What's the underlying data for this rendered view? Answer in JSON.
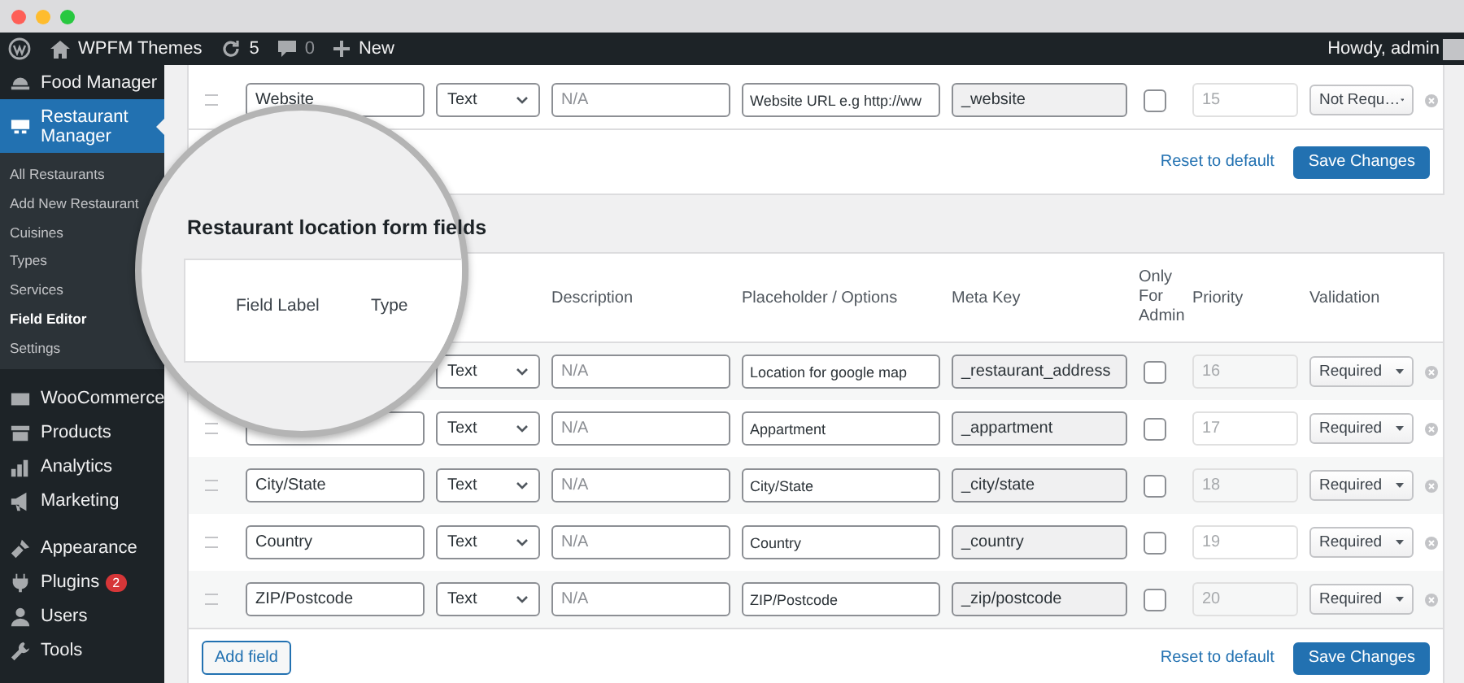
{
  "admin_bar": {
    "site": "WPFM Themes",
    "updates": "5",
    "comments": "0",
    "new": "New",
    "greeting": "Howdy, admin"
  },
  "sidebar": {
    "items": [
      {
        "label": "Food Manager",
        "selected": false
      },
      {
        "label": "Restaurant Manager",
        "selected": true,
        "children": [
          {
            "label": "All Restaurants",
            "selected": false
          },
          {
            "label": "Add New Restaurant",
            "selected": false
          },
          {
            "label": "Cuisines",
            "selected": false
          },
          {
            "label": "Types",
            "selected": false
          },
          {
            "label": "Services",
            "selected": false
          },
          {
            "label": "Field Editor",
            "selected": true
          },
          {
            "label": "Settings",
            "selected": false
          }
        ]
      },
      {
        "label": "WooCommerce",
        "selected": false
      },
      {
        "label": "Products",
        "selected": false
      },
      {
        "label": "Analytics",
        "selected": false
      },
      {
        "label": "Marketing",
        "selected": false
      },
      {
        "label": "Appearance",
        "selected": false
      },
      {
        "label": "Plugins",
        "selected": false,
        "badge": "2"
      },
      {
        "label": "Users",
        "selected": false
      },
      {
        "label": "Tools",
        "selected": false
      }
    ]
  },
  "top_card": {
    "rows": [
      {
        "kind": "field",
        "label": "Website",
        "type": "Text",
        "description": {
          "placeholder": "N/A"
        },
        "options_value": "Website URL e.g http://ww",
        "meta_key": "_website",
        "only_for_admin": false,
        "priority": "15",
        "validation": "Not Requ…"
      }
    ],
    "reset": "Reset to default",
    "save": "Save Changes"
  },
  "section": {
    "title": "Restaurant location form fields",
    "columns": [
      "Description",
      "Placeholder / Options",
      "Meta Key",
      "Only For Admin",
      "Priority",
      "Validation"
    ],
    "rows": [
      {
        "kind": "covered",
        "type": "Text",
        "description": {
          "placeholder": "N/A"
        },
        "options_value": "Location for google map",
        "meta_key": "_restaurant_address",
        "only_for_admin": false,
        "priority": "16",
        "validation": "Required"
      },
      {
        "kind": "field",
        "type": "Text",
        "description": {
          "placeholder": "N/A"
        },
        "options_value": "Appartment",
        "meta_key": "_appartment",
        "only_for_admin": false,
        "priority": "17",
        "validation": "Required"
      },
      {
        "kind": "field",
        "label": "City/State",
        "type": "Text",
        "description": {
          "placeholder": "N/A"
        },
        "options_value": "City/State",
        "meta_key": "_city/state",
        "only_for_admin": false,
        "priority": "18",
        "validation": "Required"
      },
      {
        "kind": "field",
        "label": "Country",
        "type": "Text",
        "description": {
          "placeholder": "N/A"
        },
        "options_value": "Country",
        "meta_key": "_country",
        "only_for_admin": false,
        "priority": "19",
        "validation": "Required"
      },
      {
        "kind": "field",
        "label": "ZIP/Postcode",
        "type": "Text",
        "description": {
          "placeholder": "N/A"
        },
        "options_value": "ZIP/Postcode",
        "meta_key": "_zip/postcode",
        "only_for_admin": false,
        "priority": "20",
        "validation": "Required"
      }
    ],
    "add": "Add field",
    "reset": "Reset to default",
    "save": "Save Changes"
  },
  "magnifier": {
    "columns": [
      "Field Label",
      "Type"
    ]
  }
}
